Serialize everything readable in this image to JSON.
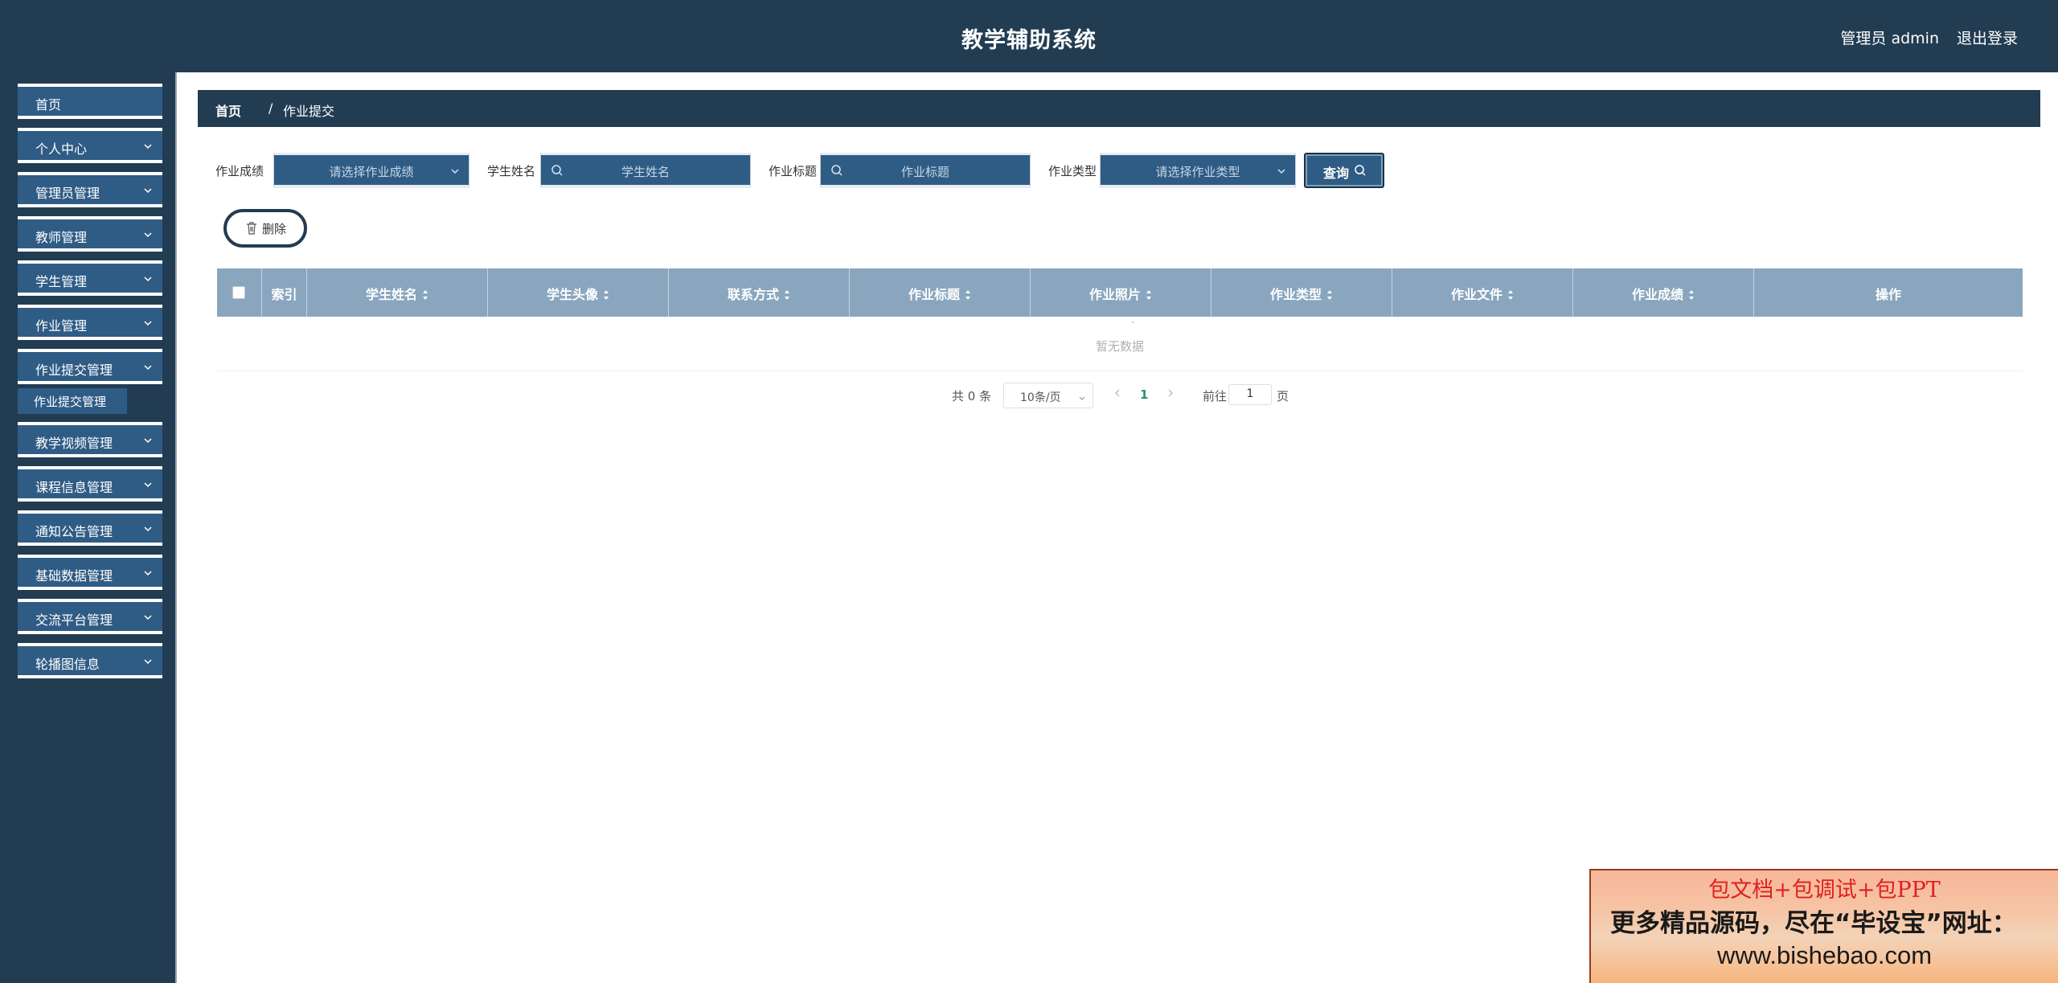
{
  "header": {
    "title": "教学辅助系统",
    "user": "管理员 admin",
    "logout": "退出登录"
  },
  "sidebar": {
    "items": [
      {
        "label": "首页",
        "expandable": false
      },
      {
        "label": "个人中心",
        "expandable": true
      },
      {
        "label": "管理员管理",
        "expandable": true
      },
      {
        "label": "教师管理",
        "expandable": true
      },
      {
        "label": "学生管理",
        "expandable": true
      },
      {
        "label": "作业管理",
        "expandable": true
      },
      {
        "label": "作业提交管理",
        "expandable": true,
        "expanded": true
      },
      {
        "label": "教学视频管理",
        "expandable": true
      },
      {
        "label": "课程信息管理",
        "expandable": true
      },
      {
        "label": "通知公告管理",
        "expandable": true
      },
      {
        "label": "基础数据管理",
        "expandable": true
      },
      {
        "label": "交流平台管理",
        "expandable": true
      },
      {
        "label": "轮播图信息",
        "expandable": true
      }
    ],
    "subitem": "作业提交管理"
  },
  "breadcrumb": {
    "home": "首页",
    "separator": "/",
    "current": "作业提交"
  },
  "filters": {
    "score_label": "作业成绩",
    "score_placeholder": "请选择作业成绩",
    "name_label": "学生姓名",
    "name_placeholder": "学生姓名",
    "title_label": "作业标题",
    "title_placeholder": "作业标题",
    "type_label": "作业类型",
    "type_placeholder": "请选择作业类型",
    "query": "查询"
  },
  "actions": {
    "delete": "删除"
  },
  "table": {
    "columns": [
      "索引",
      "学生姓名",
      "学生头像",
      "联系方式",
      "作业标题",
      "作业照片",
      "作业类型",
      "作业文件",
      "作业成绩",
      "操作"
    ],
    "empty_text": "暂无数据"
  },
  "pagination": {
    "total": "共 0 条",
    "page_size": "10条/页",
    "current_page": "1",
    "goto_label": "前往",
    "goto_value": "1",
    "page_word": "页"
  },
  "ad": {
    "line1": "包文档+包调试+包PPT",
    "line2": "更多精品源码，尽在“毕设宝”网址：",
    "line3": "www.bishebao.com"
  },
  "colors": {
    "header_bg": "#223c52",
    "menu_bg": "#2f5c85",
    "table_header": "#8aa6bf",
    "ad_text_red": "#e02020"
  }
}
